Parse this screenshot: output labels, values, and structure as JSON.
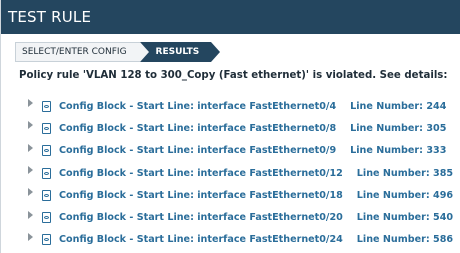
{
  "window": {
    "title": "TEST RULE"
  },
  "wizard": {
    "steps": [
      {
        "label": "SELECT/ENTER CONFIG",
        "active": false
      },
      {
        "label": "RESULTS",
        "active": true
      }
    ]
  },
  "message": "Policy rule 'VLAN 128 to 300_Copy (Fast ethernet)' is violated. See details:",
  "results": [
    {
      "label": "Config Block - Start Line: interface FastEthernet0/4",
      "line": "Line Number: 244"
    },
    {
      "label": "Config Block - Start Line: interface FastEthernet0/8",
      "line": "Line Number: 305"
    },
    {
      "label": "Config Block - Start Line: interface FastEthernet0/9",
      "line": "Line Number: 333"
    },
    {
      "label": "Config Block - Start Line: interface FastEthernet0/12",
      "line": "Line Number: 385"
    },
    {
      "label": "Config Block - Start Line: interface FastEthernet0/18",
      "line": "Line Number: 496"
    },
    {
      "label": "Config Block - Start Line: interface FastEthernet0/20",
      "line": "Line Number: 540"
    },
    {
      "label": "Config Block - Start Line: interface FastEthernet0/24",
      "line": "Line Number: 586"
    }
  ],
  "colors": {
    "title_bar": "#24465f",
    "link": "#2a6d9a",
    "text": "#1f2d38"
  },
  "icons": {
    "expander": "triangle-right-icon",
    "row": "document-icon"
  }
}
